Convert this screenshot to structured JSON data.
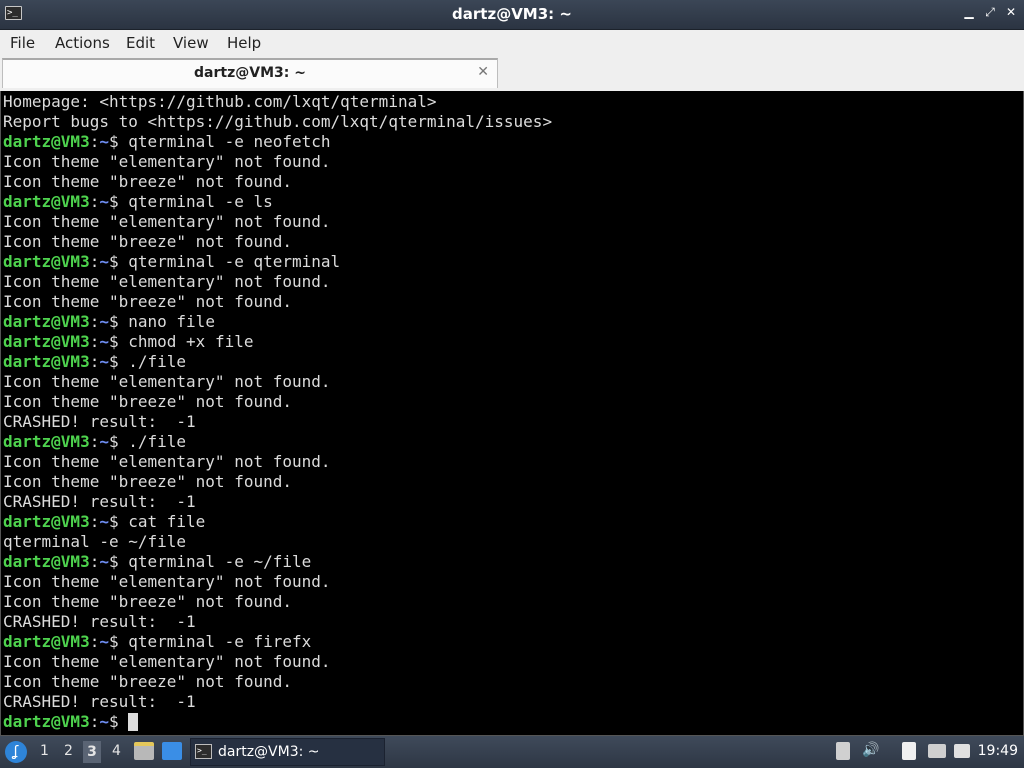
{
  "window": {
    "title": "dartz@VM3: ~",
    "app_icon_glyph": ">_",
    "controls": {
      "minimize": "▁",
      "maximize": "⤢",
      "close": "✕"
    }
  },
  "menu": [
    "File",
    "Actions",
    "Edit",
    "View",
    "Help"
  ],
  "tab": {
    "title": "dartz@VM3: ~",
    "close": "✕"
  },
  "prompt": {
    "user": "dartz@VM3",
    "colon": ":",
    "path": "~",
    "symbol": "$ "
  },
  "terminal_lines": [
    {
      "type": "out",
      "text": "Homepage: <https://github.com/lxqt/qterminal>"
    },
    {
      "type": "out",
      "text": "Report bugs to <https://github.com/lxqt/qterminal/issues>"
    },
    {
      "type": "cmd",
      "text": "qterminal -e neofetch"
    },
    {
      "type": "out",
      "text": "Icon theme \"elementary\" not found."
    },
    {
      "type": "out",
      "text": "Icon theme \"breeze\" not found."
    },
    {
      "type": "cmd",
      "text": "qterminal -e ls"
    },
    {
      "type": "out",
      "text": "Icon theme \"elementary\" not found."
    },
    {
      "type": "out",
      "text": "Icon theme \"breeze\" not found."
    },
    {
      "type": "cmd",
      "text": "qterminal -e qterminal"
    },
    {
      "type": "out",
      "text": "Icon theme \"elementary\" not found."
    },
    {
      "type": "out",
      "text": "Icon theme \"breeze\" not found."
    },
    {
      "type": "cmd",
      "text": "nano file"
    },
    {
      "type": "cmd",
      "text": "chmod +x file"
    },
    {
      "type": "cmd",
      "text": "./file"
    },
    {
      "type": "out",
      "text": "Icon theme \"elementary\" not found."
    },
    {
      "type": "out",
      "text": "Icon theme \"breeze\" not found."
    },
    {
      "type": "out",
      "text": "CRASHED! result:  -1"
    },
    {
      "type": "cmd",
      "text": "./file"
    },
    {
      "type": "out",
      "text": "Icon theme \"elementary\" not found."
    },
    {
      "type": "out",
      "text": "Icon theme \"breeze\" not found."
    },
    {
      "type": "out",
      "text": "CRASHED! result:  -1"
    },
    {
      "type": "cmd",
      "text": "cat file"
    },
    {
      "type": "out",
      "text": "qterminal -e ~/file"
    },
    {
      "type": "cmd",
      "text": "qterminal -e ~/file"
    },
    {
      "type": "out",
      "text": "Icon theme \"elementary\" not found."
    },
    {
      "type": "out",
      "text": "Icon theme \"breeze\" not found."
    },
    {
      "type": "out",
      "text": "CRASHED! result:  -1"
    },
    {
      "type": "cmd",
      "text": "qterminal -e firefx"
    },
    {
      "type": "out",
      "text": "Icon theme \"elementary\" not found."
    },
    {
      "type": "out",
      "text": "Icon theme \"breeze\" not found."
    },
    {
      "type": "out",
      "text": "CRASHED! result:  -1"
    },
    {
      "type": "active",
      "text": ""
    }
  ],
  "taskbar": {
    "start_glyph": "ʆ",
    "workspaces": [
      "1",
      "2",
      "3",
      "4"
    ],
    "active_workspace": "3",
    "task_label": "dartz@VM3: ~",
    "task_icon_glyph": ">_",
    "clock": "19:49",
    "volume_glyph": "🔊"
  },
  "colors": {
    "prompt_user": "#4ed34e",
    "prompt_path": "#6f8ef3",
    "terminal_bg": "#000000",
    "terminal_fg": "#dcdcdc"
  }
}
